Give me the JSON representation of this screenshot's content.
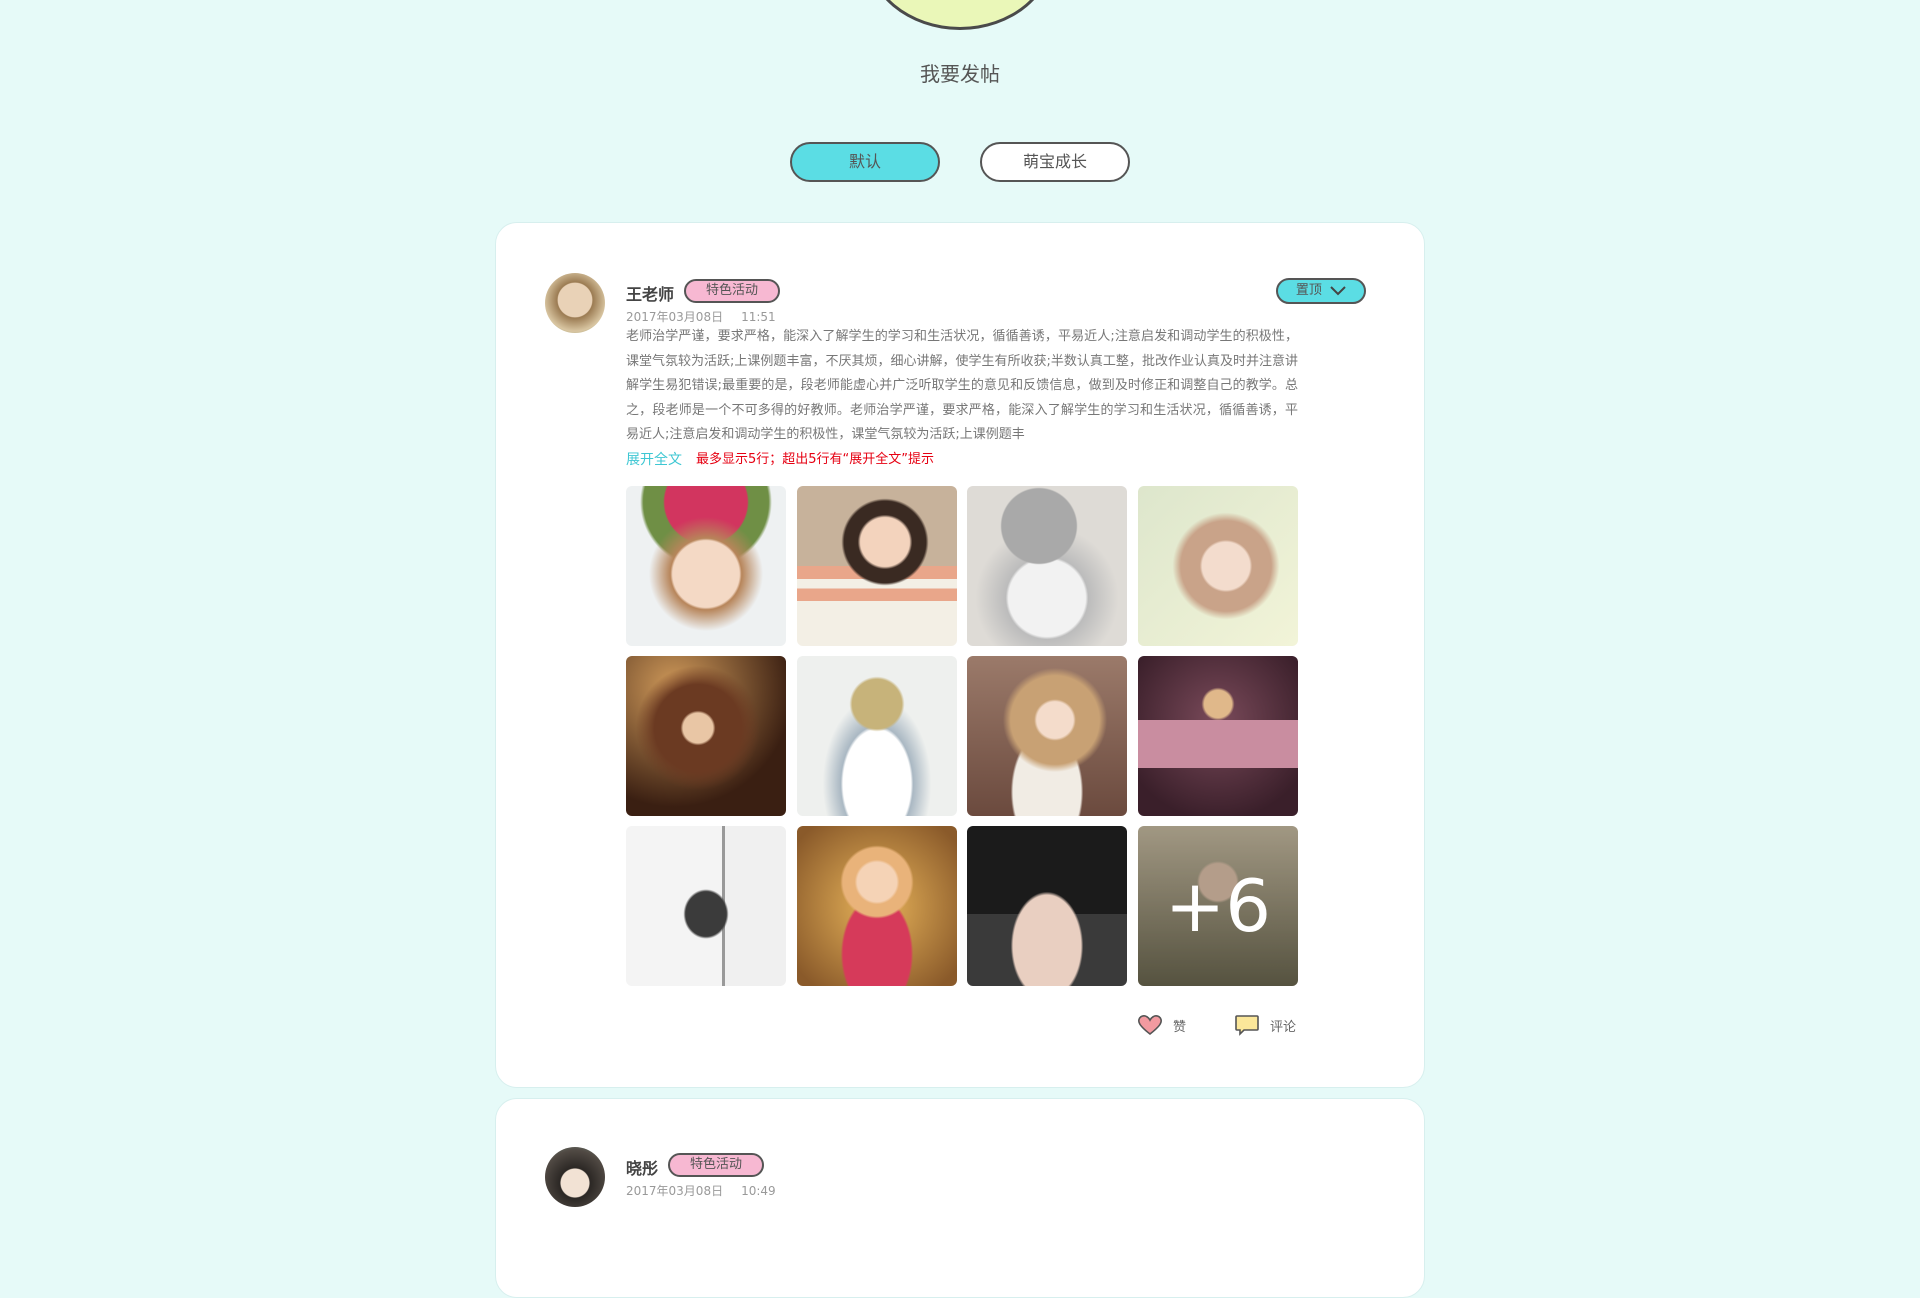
{
  "page": {
    "post_button_label": "我要发帖",
    "tabs": [
      {
        "label": "默认",
        "active": true
      },
      {
        "label": "萌宝成长",
        "active": false
      }
    ]
  },
  "posts": [
    {
      "author": "王老师",
      "tag": "特色活动",
      "date": "2017年03月08日",
      "time": "11:51",
      "pin_label": "置顶",
      "content": "老师治学严谨，要求严格，能深入了解学生的学习和生活状况，循循善诱，平易近人;注意启发和调动学生的积极性，课堂气氛较为活跃;上课例题丰富，不厌其烦，细心讲解，使学生有所收获;半数认真工整，批改作业认真及时并注意讲解学生易犯错误;最重要的是，段老师能虚心并广泛听取学生的意见和反馈信息，做到及时修正和调整自己的教学。总之，段老师是一个不可多得的好教师。老师治学严谨，要求严格，能深入了解学生的学习和生活状况，循循善诱，平易近人;注意启发和调动学生的积极性，课堂气氛较为活跃;上课例题丰",
      "expand_label": "展开全文",
      "hint": "最多显示5行；超出5行有“展开全文”提示",
      "more_photos": "+6",
      "like_label": "赞",
      "comment_label": "评论"
    },
    {
      "author": "晓彤",
      "tag": "特色活动",
      "date": "2017年03月08日",
      "time": "10:49"
    }
  ],
  "colors": {
    "background": "#e6faf8",
    "accent": "#5bdde4",
    "tag_pink": "#f7b8d2",
    "hint_red": "#e60012",
    "link_cyan": "#3ec7d3"
  },
  "icons": {
    "pin_dropdown": "chevron-down-icon",
    "like": "heart-icon",
    "comment": "comment-bubble-icon"
  }
}
